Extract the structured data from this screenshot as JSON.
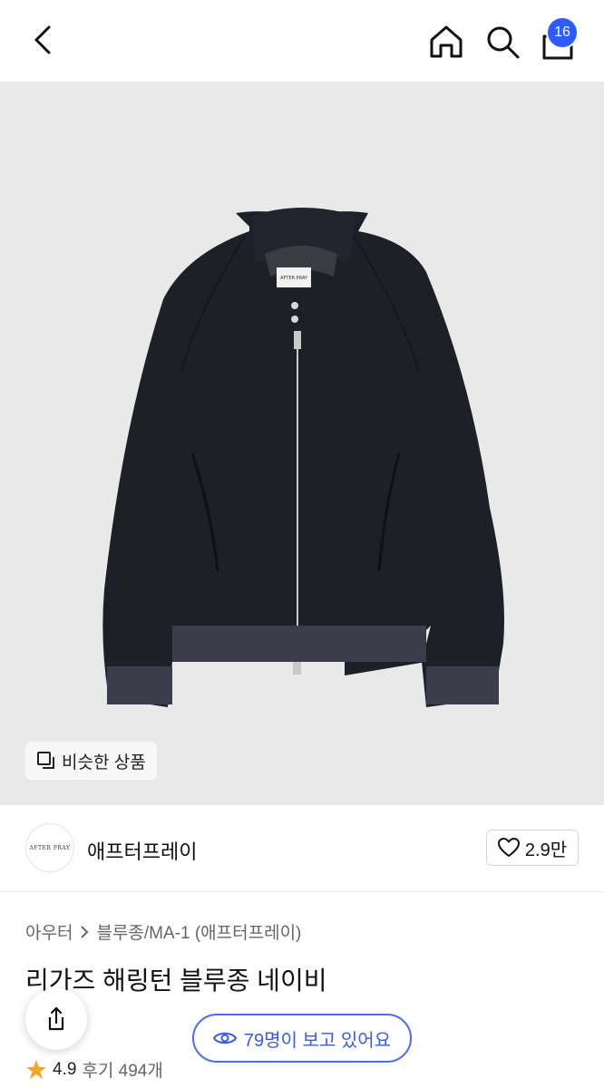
{
  "header": {
    "cart_count": "16"
  },
  "image": {
    "similar_label": "비슷한 상품",
    "tag_text": "AFTER PRAY"
  },
  "brand": {
    "logo_text": "AFTER PRAY",
    "name": "애프터프레이",
    "likes": "2.9만"
  },
  "category": {
    "parent": "아우터",
    "child": "블루종/MA-1 (애프터프레이)"
  },
  "product": {
    "title": "리가즈 해링턴 블루종 네이비"
  },
  "viewers": {
    "text": "79명이 보고 있어요"
  },
  "rating": {
    "score": "4.9",
    "reviews": "후기 494개"
  },
  "colors": {
    "accent": "#2d5bff",
    "star": "#f5a623",
    "jacket": "#1e2028",
    "background": "#e9e9e9"
  }
}
